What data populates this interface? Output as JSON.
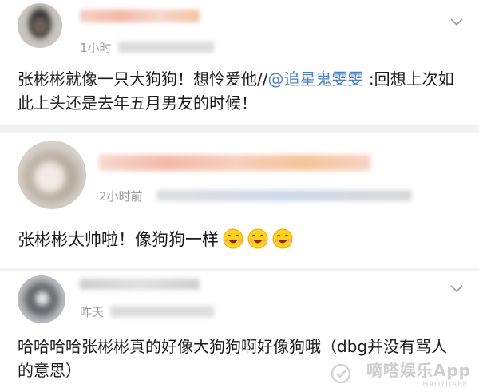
{
  "comments": [
    {
      "time": "1小时",
      "text_prefix": "张彬彬就像一只大狗狗！想怜爱他//",
      "mention": "@追星鬼雯雯",
      "text_suffix": ":回想上次如此上头还是去年五月男友的时候！"
    },
    {
      "time": "2小时前",
      "text": "张彬彬太帅啦！像狗狗一样",
      "emoji_count": 3
    },
    {
      "time": "昨天",
      "text": "哈哈哈哈张彬彬真的好像大狗狗啊好像狗哦（dbg并没有骂人的意思）"
    }
  ],
  "watermark": {
    "text": "嘀嗒娱乐App",
    "sub": "HAOYUAPP"
  },
  "icons": {
    "dropdown": "chevron-down-icon",
    "emoji": "laughing-face-emoji"
  },
  "colors": {
    "mention": "#4a7fc1",
    "time": "#9b9b9b",
    "separator": "#f2f2f2"
  }
}
